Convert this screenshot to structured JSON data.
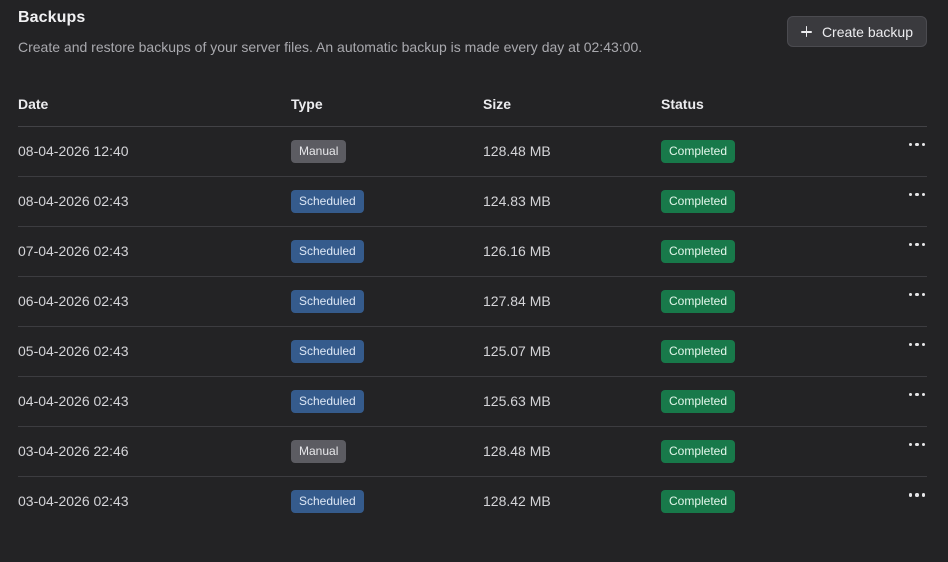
{
  "header": {
    "title": "Backups",
    "subtitle": "Create and restore backups of your server files. An automatic backup is made every day at 02:43:00.",
    "create_button_label": "Create backup"
  },
  "table": {
    "columns": [
      "Date",
      "Type",
      "Size",
      "Status"
    ],
    "rows": [
      {
        "date": "08-04-2026 12:40",
        "type": "Manual",
        "size": "128.48 MB",
        "status": "Completed"
      },
      {
        "date": "08-04-2026 02:43",
        "type": "Scheduled",
        "size": "124.83 MB",
        "status": "Completed"
      },
      {
        "date": "07-04-2026 02:43",
        "type": "Scheduled",
        "size": "126.16 MB",
        "status": "Completed"
      },
      {
        "date": "06-04-2026 02:43",
        "type": "Scheduled",
        "size": "127.84 MB",
        "status": "Completed"
      },
      {
        "date": "05-04-2026 02:43",
        "type": "Scheduled",
        "size": "125.07 MB",
        "status": "Completed"
      },
      {
        "date": "04-04-2026 02:43",
        "type": "Scheduled",
        "size": "125.63 MB",
        "status": "Completed"
      },
      {
        "date": "03-04-2026 22:46",
        "type": "Manual",
        "size": "128.48 MB",
        "status": "Completed"
      },
      {
        "date": "03-04-2026 02:43",
        "type": "Scheduled",
        "size": "128.42 MB",
        "status": "Completed"
      }
    ]
  },
  "icons": {
    "create": "plus-icon",
    "row_menu": "more-horizontal-icon"
  },
  "colors": {
    "background": "#232325",
    "manual_badge": "#5c5c62",
    "scheduled_badge": "#355b8c",
    "completed_badge": "#18794a"
  }
}
